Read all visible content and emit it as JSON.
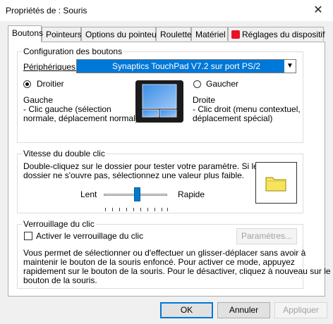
{
  "window": {
    "title": "Propriétés de : Souris",
    "close_glyph": "✕"
  },
  "tabs": [
    {
      "label": "Boutons"
    },
    {
      "label": "Pointeurs"
    },
    {
      "label": "Options du pointeur"
    },
    {
      "label": "Roulette"
    },
    {
      "label": "Matériel"
    },
    {
      "label": "Réglages du dispositif"
    }
  ],
  "buttons_config": {
    "legend": "Configuration des boutons",
    "device_label": "Périphériques :",
    "device_value": "Synaptics TouchPad V7.2 sur port PS/2",
    "right_handed": {
      "label": "Droitier",
      "selected": true
    },
    "left_handed": {
      "label": "Gaucher",
      "selected": false
    },
    "left_desc_title": "Gauche",
    "left_desc_lines": [
      "- Clic gauche (sélection",
      "normale, déplacement normal)"
    ],
    "right_desc_title": "Droite",
    "right_desc_lines": [
      "- Clic droit (menu contextuel,",
      "déplacement spécial)"
    ]
  },
  "double_click": {
    "legend": "Vitesse du double clic",
    "desc_lines": [
      "Double-cliquez sur le dossier pour tester votre paramètre. Si le",
      "dossier ne s'ouvre pas, sélectionnez une valeur plus faible."
    ],
    "slow_label": "Lent",
    "fast_label": "Rapide",
    "speed_fraction": 0.5
  },
  "click_lock": {
    "legend": "Verrouillage du clic",
    "checkbox_label": "Activer le verrouillage du clic",
    "checked": false,
    "settings_button": "Paramètres...",
    "desc_lines": [
      "Vous permet de sélectionner ou d'effectuer un glisser-déplacer sans avoir à",
      "maintenir le bouton de la souris enfoncé. Pour activer ce mode, appuyez",
      "rapidement sur le bouton de la souris. Pour le désactiver, cliquez à nouveau sur le",
      "bouton de la souris."
    ]
  },
  "footer": {
    "ok": "OK",
    "cancel": "Annuler",
    "apply": "Appliquer"
  },
  "colors": {
    "accent": "#0078d7",
    "tab_icon": "#e81123",
    "folder": "#f7e35d"
  }
}
